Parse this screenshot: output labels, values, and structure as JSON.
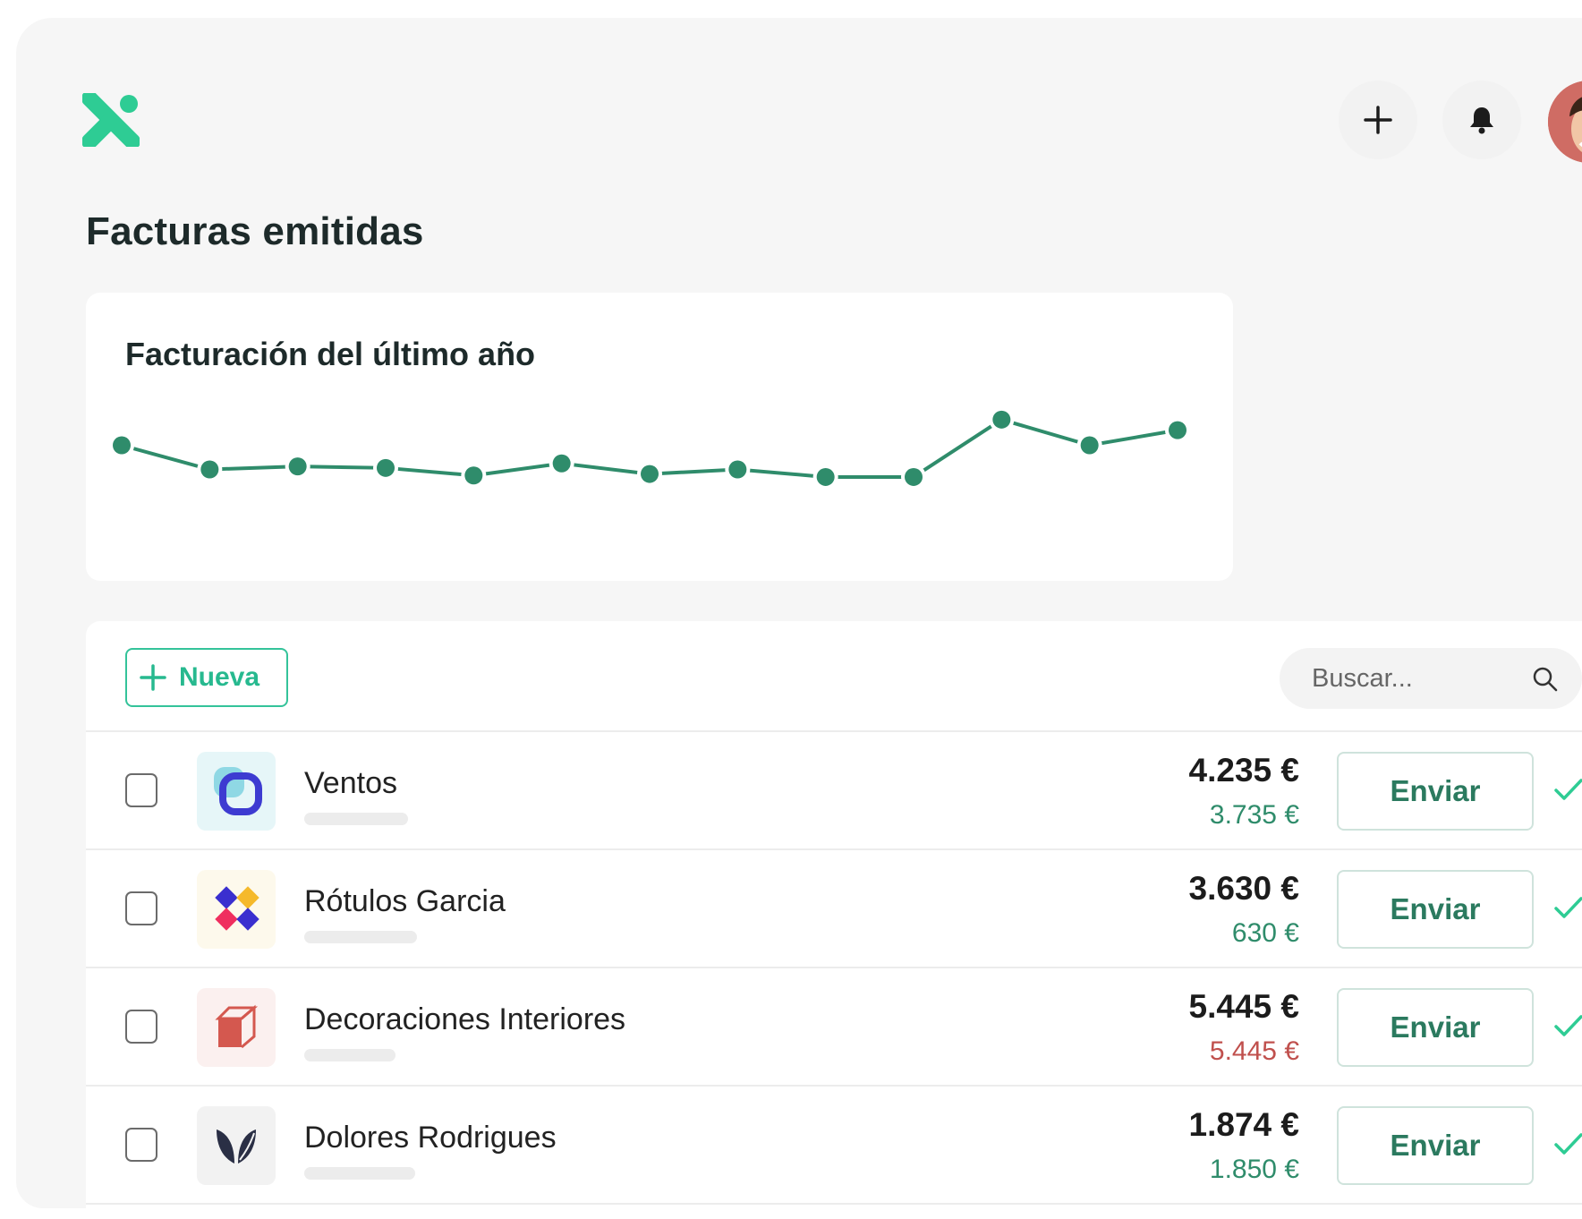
{
  "header": {
    "logo_icon": "x-logo-icon",
    "add_icon": "plus-icon",
    "notifications_icon": "bell-icon",
    "avatar_icon": "user-avatar"
  },
  "page": {
    "title": "Facturas emitidas"
  },
  "chart_card": {
    "title": "Facturación del último año"
  },
  "chart_data": {
    "type": "line",
    "title": "Facturación del último año",
    "series": [
      {
        "values": [
          56,
          40,
          42,
          41,
          36,
          44,
          37,
          40,
          35,
          35,
          73,
          56,
          66
        ]
      }
    ],
    "ylim": [
      0,
      100
    ],
    "color": "#2f8c6b",
    "grid": false,
    "axes_visible": false
  },
  "toolbar": {
    "new_label": "Nueva",
    "search_placeholder": "Buscar...",
    "search_icon": "search-icon"
  },
  "invoices": [
    {
      "company": "Ventos",
      "amount": "4.235 €",
      "sub_amount": "3.735 €",
      "sub_color": "#2f8c6b",
      "send_label": "Enviar",
      "logo": "ventos-logo"
    },
    {
      "company": "Rótulos Garcia",
      "amount": "3.630 €",
      "sub_amount": "630 €",
      "sub_color": "#2f8c6b",
      "send_label": "Enviar",
      "logo": "rotulos-logo"
    },
    {
      "company": "Decoraciones Interiores",
      "amount": "5.445 €",
      "sub_amount": "5.445 €",
      "sub_color": "#c0504d",
      "send_label": "Enviar",
      "logo": "decoraciones-logo"
    },
    {
      "company": "Dolores Rodrigues",
      "amount": "1.874 €",
      "sub_amount": "1.850 €",
      "sub_color": "#2f8c6b",
      "send_label": "Enviar",
      "logo": "dolores-logo"
    }
  ],
  "colors": {
    "accent": "#27b98f",
    "chart_line": "#2f8c6b",
    "positive": "#2f8c6b",
    "negative": "#c0504d"
  }
}
